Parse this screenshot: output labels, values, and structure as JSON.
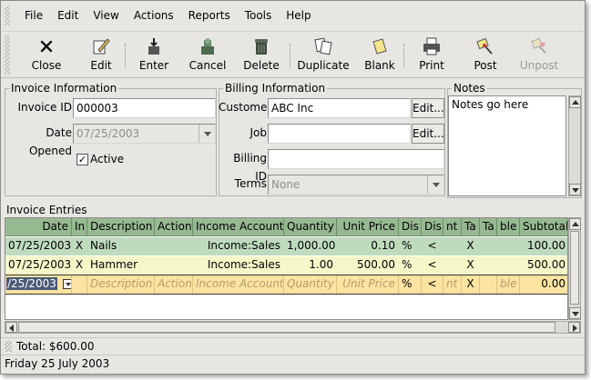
{
  "menu": [
    "File",
    "Edit",
    "View",
    "Actions",
    "Reports",
    "Tools",
    "Help"
  ],
  "toolbar": {
    "close": "Close",
    "edit": "Edit",
    "enter": "Enter",
    "cancel": "Cancel",
    "delete": "Delete",
    "duplicate": "Duplicate",
    "blank": "Blank",
    "print": "Print",
    "post": "Post",
    "unpost": "Unpost"
  },
  "invoice_info": {
    "title": "Invoice Information",
    "id_label": "Invoice ID",
    "id_value": "000003",
    "date_label": "Date Opened",
    "date_value": "07/25/2003",
    "active_label": "Active",
    "active_checked": true
  },
  "billing": {
    "title": "Billing Information",
    "customer_label": "Customer",
    "customer_value": "ABC Inc",
    "edit_label": "Edit...",
    "job_label": "Job",
    "job_value": "",
    "job_edit_label": "Edit...",
    "billing_id_label": "Billing ID",
    "billing_id_value": "",
    "terms_label": "Terms",
    "terms_value": "None"
  },
  "notes": {
    "title": "Notes",
    "text": "Notes go here"
  },
  "entries": {
    "title": "Invoice Entries",
    "headers": [
      "Date",
      "In",
      "Description",
      "Action",
      "Income Account",
      "Quantity",
      "Unit Price",
      "Dis",
      "Dis",
      "nt",
      "Ta",
      "Ta",
      "ble",
      "Subtotal"
    ],
    "rows": [
      [
        "07/25/2003",
        "X",
        "Nails",
        "",
        "Income:Sales",
        "1,000.00",
        "0.10",
        "%",
        "<",
        "",
        "X",
        "",
        "",
        "100.00"
      ],
      [
        "07/25/2003",
        "X",
        "Hammer",
        "",
        "Income:Sales",
        "1.00",
        "500.00",
        "%",
        "<",
        "",
        "X",
        "",
        "",
        "500.00"
      ]
    ],
    "blank_row": [
      "/25/2003",
      "",
      "Description",
      "Action",
      "Income Account",
      "Quantity",
      "Unit Price",
      "%",
      "<",
      "nt",
      "X",
      "",
      "ble",
      "0.00"
    ]
  },
  "status": {
    "total": "Total: $600.00",
    "date": "Friday 25 July 2003"
  }
}
